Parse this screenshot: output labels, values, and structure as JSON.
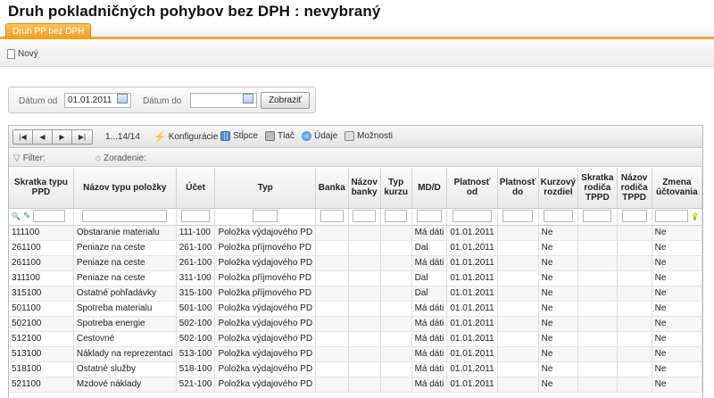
{
  "title": "Druh pokladničných pohybov bez DPH :  nevybraný",
  "tab": "Druh PP bez DPH",
  "toolbar": {
    "new_label": "Nový"
  },
  "filter": {
    "date_from_label": "Dátum od",
    "date_from_value": "01.01.2011",
    "date_to_label": "Dátum do",
    "date_to_value": "",
    "show_label": "Zobraziť"
  },
  "grid_toolbar": {
    "pager_buttons": [
      "|◀",
      "◀",
      "▶",
      "▶|"
    ],
    "page_info": "1...14/14",
    "config": "Konfigurácie",
    "columns": "Stĺpce",
    "print": "Tlač",
    "data": "Údaje",
    "options": "Možnosti"
  },
  "filter_row": {
    "filter": "Filter:",
    "sort": "Zoradenie:"
  },
  "columns": [
    "Skratka typu PPD",
    "Názov typu položky",
    "Účet",
    "Typ",
    "Banka",
    "Názov banky",
    "Typ kurzu",
    "MD/D",
    "Platnosť od",
    "Platnosť do",
    "Kurzový rozdiel",
    "Skratka rodiča TPPD",
    "Názov rodiča TPPD",
    "Zmena účtovania"
  ],
  "rows": [
    [
      "111100",
      "Obstaranie materialu",
      "111-100",
      "Položka výdajového PD",
      "",
      "",
      "",
      "Má dáti",
      "01.01.2011",
      "",
      "Ne",
      "",
      "",
      "Ne"
    ],
    [
      "261100",
      "Peniaze na ceste",
      "261-100",
      "Položka příjmového PD",
      "",
      "",
      "",
      "Dal",
      "01.01.2011",
      "",
      "Ne",
      "",
      "",
      "Ne"
    ],
    [
      "261100",
      "Peniaze na ceste",
      "261-100",
      "Položka výdajového PD",
      "",
      "",
      "",
      "Má dáti",
      "01.01.2011",
      "",
      "Ne",
      "",
      "",
      "Ne"
    ],
    [
      "311100",
      "Peniaze na ceste",
      "311-100",
      "Položka příjmového PD",
      "",
      "",
      "",
      "Dal",
      "01.01.2011",
      "",
      "Ne",
      "",
      "",
      "Ne"
    ],
    [
      "315100",
      "Ostatné pohľadávky",
      "315-100",
      "Položka příjmového PD",
      "",
      "",
      "",
      "Dal",
      "01.01.2011",
      "",
      "Ne",
      "",
      "",
      "Ne"
    ],
    [
      "501100",
      "Spotreba materialu",
      "501-100",
      "Položka výdajového PD",
      "",
      "",
      "",
      "Má dáti",
      "01.01.2011",
      "",
      "Ne",
      "",
      "",
      "Ne"
    ],
    [
      "502100",
      "Spotreba energie",
      "502-100",
      "Položka výdajového PD",
      "",
      "",
      "",
      "Má dáti",
      "01.01.2011",
      "",
      "Ne",
      "",
      "",
      "Ne"
    ],
    [
      "512100",
      "Cestovné",
      "502-100",
      "Položka výdajového PD",
      "",
      "",
      "",
      "Má dáti",
      "01.01.2011",
      "",
      "Ne",
      "",
      "",
      "Ne"
    ],
    [
      "513100",
      "Náklady na reprezentaci",
      "513-100",
      "Položka výdajového PD",
      "",
      "",
      "",
      "Má dáti",
      "01.01.2011",
      "",
      "Ne",
      "",
      "",
      "Ne"
    ],
    [
      "518100",
      "Ostatné služby",
      "518-100",
      "Položka výdajového PD",
      "",
      "",
      "",
      "Má dáti",
      "01.01.2011",
      "",
      "Ne",
      "",
      "",
      "Ne"
    ],
    [
      "521100",
      "Mzdové náklady",
      "521-100",
      "Položka výdajového PD",
      "",
      "",
      "",
      "Má dáti",
      "01.01.2011",
      "",
      "Ne",
      "",
      "",
      "Ne"
    ]
  ]
}
